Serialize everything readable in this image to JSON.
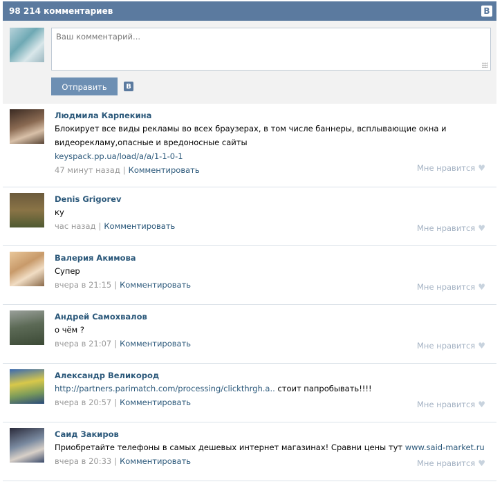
{
  "header": {
    "title": "98 214 комментариев",
    "logo": "В"
  },
  "compose": {
    "placeholder": "Ваш комментарий...",
    "send_label": "Отправить",
    "logo": "В"
  },
  "comments": [
    {
      "author": "Людмила Карпекина",
      "text": "Блокирует все виды рекламы во всех браузерах, в том числе баннеры, всплывающие окна и видеорекламу,опасные и вредоносные сайты",
      "link": "keyspack.pp.ua/load/a/a/1-1-0-1",
      "time": "47 минут назад",
      "reply": "Комментировать",
      "like": "Мне нравится"
    },
    {
      "author": "Denis Grigorev",
      "text": "ку",
      "time": "час назад",
      "reply": "Комментировать",
      "like": "Мне нравится"
    },
    {
      "author": "Валерия Акимова",
      "text": "Супер",
      "time": "вчера в 21:15",
      "reply": "Комментировать",
      "like": "Мне нравится"
    },
    {
      "author": "Андрей Самохвалов",
      "text": "о чём ?",
      "time": "вчера в 21:07",
      "reply": "Комментировать",
      "like": "Мне нравится"
    },
    {
      "author": "Александр Великород",
      "text_link": "http://partners.parimatch.com/processing/clickthrgh.a..",
      "text": " стоит папробывать!!!!",
      "time": "вчера в 20:57",
      "reply": "Комментировать",
      "like": "Мне нравится"
    },
    {
      "author": "Саид Закиров",
      "text": "Приобретайте телефоны в самых дешевых интернет магазинах! Сравни цены тут ",
      "text_link": "www.said-market.ru",
      "time": "вчера в 20:33",
      "reply": "Комментировать",
      "like": "Мне нравится"
    }
  ]
}
